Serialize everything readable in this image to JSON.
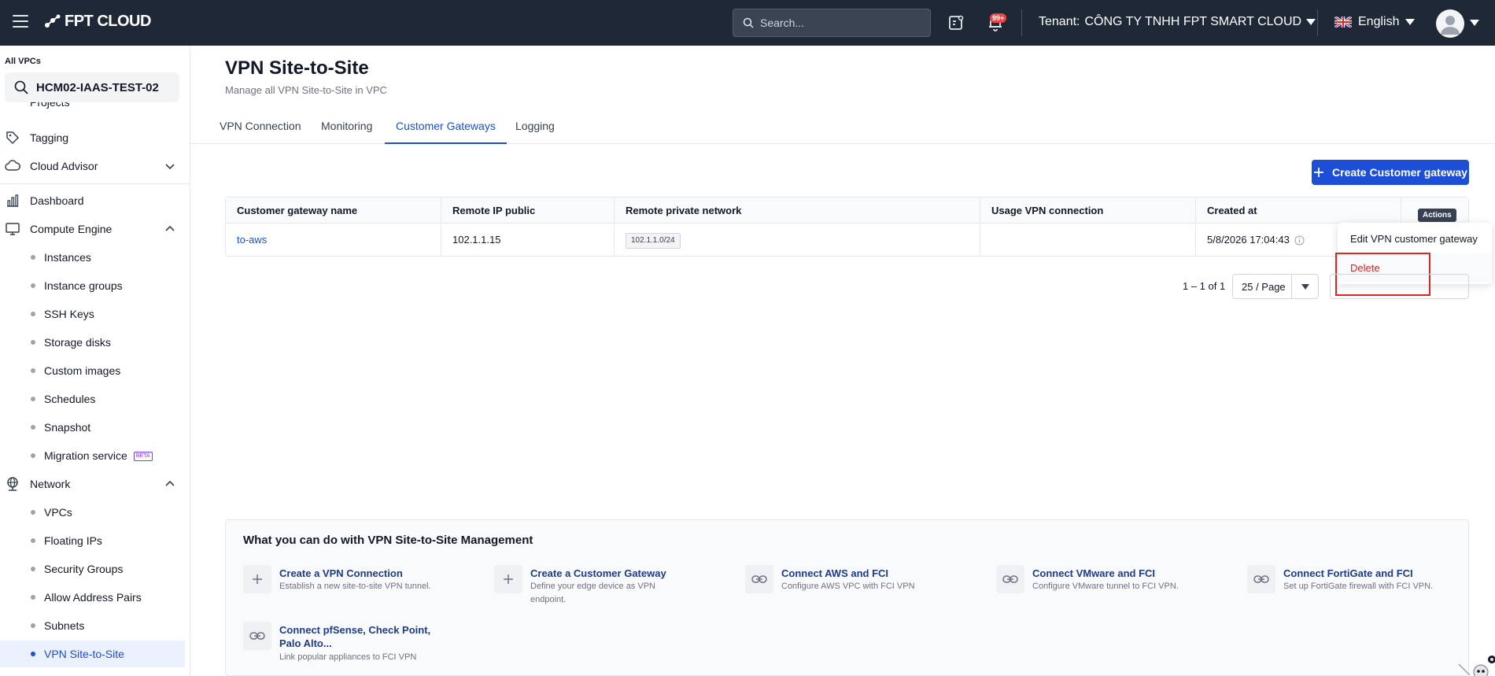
{
  "topbar": {
    "brand": "FPT CLOUD",
    "search_placeholder": "Search...",
    "notifications_badge": "99+",
    "tenant_label": "Tenant:",
    "tenant_name": "CÔNG TY TNHH FPT SMART CLOUD",
    "language": "English"
  },
  "sidebar": {
    "scope_label": "All VPCs",
    "vpc_name": "HCM02-IAAS-TEST-02",
    "partial_item": "Projects",
    "items": {
      "tagging": "Tagging",
      "cloud_advisor": "Cloud Advisor",
      "dashboard": "Dashboard",
      "compute_engine": "Compute Engine",
      "network": "Network"
    },
    "compute_sub": [
      "Instances",
      "Instance groups",
      "SSH Keys",
      "Storage disks",
      "Custom images",
      "Schedules",
      "Snapshot",
      "Migration service"
    ],
    "beta_label": "BETA",
    "network_sub": [
      "VPCs",
      "Floating IPs",
      "Security Groups",
      "Allow Address Pairs",
      "Subnets",
      "VPN Site-to-Site"
    ]
  },
  "page": {
    "title": "VPN Site-to-Site",
    "subtitle": "Manage all VPN Site-to-Site in VPC"
  },
  "tabs": [
    "VPN Connection",
    "Monitoring",
    "Customer Gateways",
    "Logging"
  ],
  "create_button": "Create Customer gateway",
  "table": {
    "headers": [
      "Customer gateway name",
      "Remote IP public",
      "Remote private network",
      "Usage VPN connection",
      "Created at"
    ],
    "rows": [
      {
        "name": "to-aws",
        "remote_ip": "102.1.1.15",
        "private_network": "102.1.1.0/24",
        "usage": "",
        "created_at": "5/8/2026 17:04:43"
      }
    ]
  },
  "actions": {
    "tooltip": "Actions",
    "edit": "Edit VPN customer gateway",
    "delete": "Delete"
  },
  "pagination": {
    "range": "1 – 1 of 1",
    "page_size": "25 / Page"
  },
  "what_you_can_do": {
    "title": "What you can do with VPN Site-to-Site Management",
    "cards": [
      {
        "title": "Create a VPN Connection",
        "desc": "Establish a new site-to-site VPN tunnel.",
        "icon": "plus-icon"
      },
      {
        "title": "Create a Customer Gateway",
        "desc": "Define your edge device as VPN endpoint.",
        "icon": "plus-icon"
      },
      {
        "title": "Connect AWS and FCI",
        "desc": "Configure AWS VPC with FCI VPN",
        "icon": "link-icon"
      },
      {
        "title": "Connect VMware and FCI",
        "desc": "Configure VMware tunnel to FCI VPN.",
        "icon": "link-icon"
      },
      {
        "title": "Connect FortiGate and FCI",
        "desc": "Set up FortiGate firewall with FCI VPN.",
        "icon": "link-icon"
      },
      {
        "title": "Connect pfSense, Check Point, Palo Alto...",
        "desc": "Link popular appliances to FCI VPN",
        "icon": "link-icon"
      }
    ]
  },
  "colors": {
    "topbar": "#1e2836",
    "accent": "#1d4ed8",
    "danger": "#dc2626"
  }
}
